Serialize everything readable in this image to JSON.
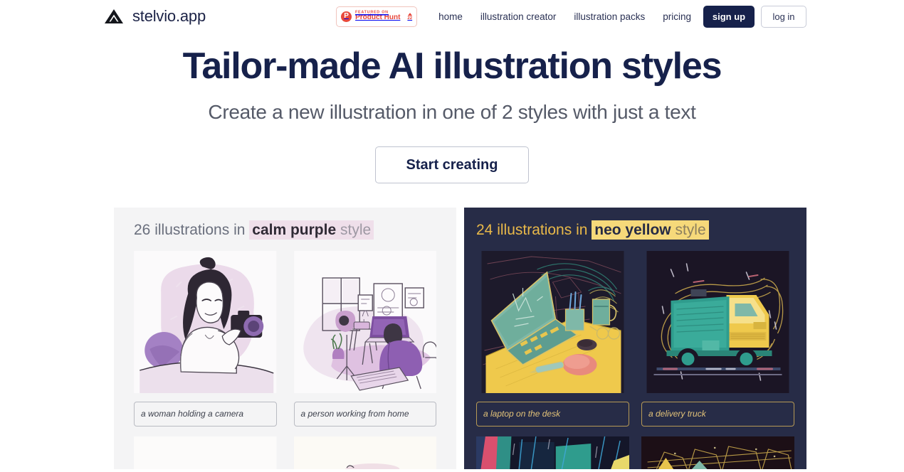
{
  "header": {
    "logo_icon": "triangle-logo-icon",
    "brand_name": "stelvio.app",
    "product_hunt": {
      "logo_letter": "P",
      "featured_text": "FEATURED ON",
      "name": "Product Hunt",
      "upvote_count": "22",
      "caret_icon": "caret-up-icon"
    },
    "nav": [
      {
        "label": "home"
      },
      {
        "label": "illustration creator"
      },
      {
        "label": "illustration packs"
      },
      {
        "label": "pricing"
      }
    ],
    "signup_label": "sign up",
    "login_label": "log in"
  },
  "hero": {
    "title": "Tailor-made AI illustration styles",
    "subtitle": "Create a new illustration in one of 2 styles with just a text",
    "cta_label": "Start creating"
  },
  "panels": [
    {
      "id": "calm-purple",
      "count_text": "26 illustrations in",
      "style_name": "calm purple",
      "style_suffix": "style",
      "cards": [
        {
          "caption": "a woman holding a camera",
          "art": "woman-with-camera"
        },
        {
          "caption": "a person working from home",
          "art": "home-office"
        },
        {
          "caption": "",
          "art": "cut-off-light-1"
        },
        {
          "caption": "",
          "art": "cut-off-light-2"
        }
      ]
    },
    {
      "id": "neo-yellow",
      "count_text": "24 illustrations in",
      "style_name": "neo yellow",
      "style_suffix": "style",
      "cards": [
        {
          "caption": "a laptop on the desk",
          "art": "laptop-desk"
        },
        {
          "caption": "a delivery truck",
          "art": "delivery-truck"
        },
        {
          "caption": "",
          "art": "cut-off-dark-1"
        },
        {
          "caption": "",
          "art": "cut-off-dark-2"
        }
      ]
    }
  ],
  "colors": {
    "brand_navy": "#16214b",
    "dark_panel": "#272c47",
    "light_panel": "#f4f4f5",
    "accent_yellow": "#e9b949",
    "highlight_purple": "#efdfea",
    "highlight_yellow": "#f6d97a",
    "product_hunt_red": "#e8483c"
  }
}
